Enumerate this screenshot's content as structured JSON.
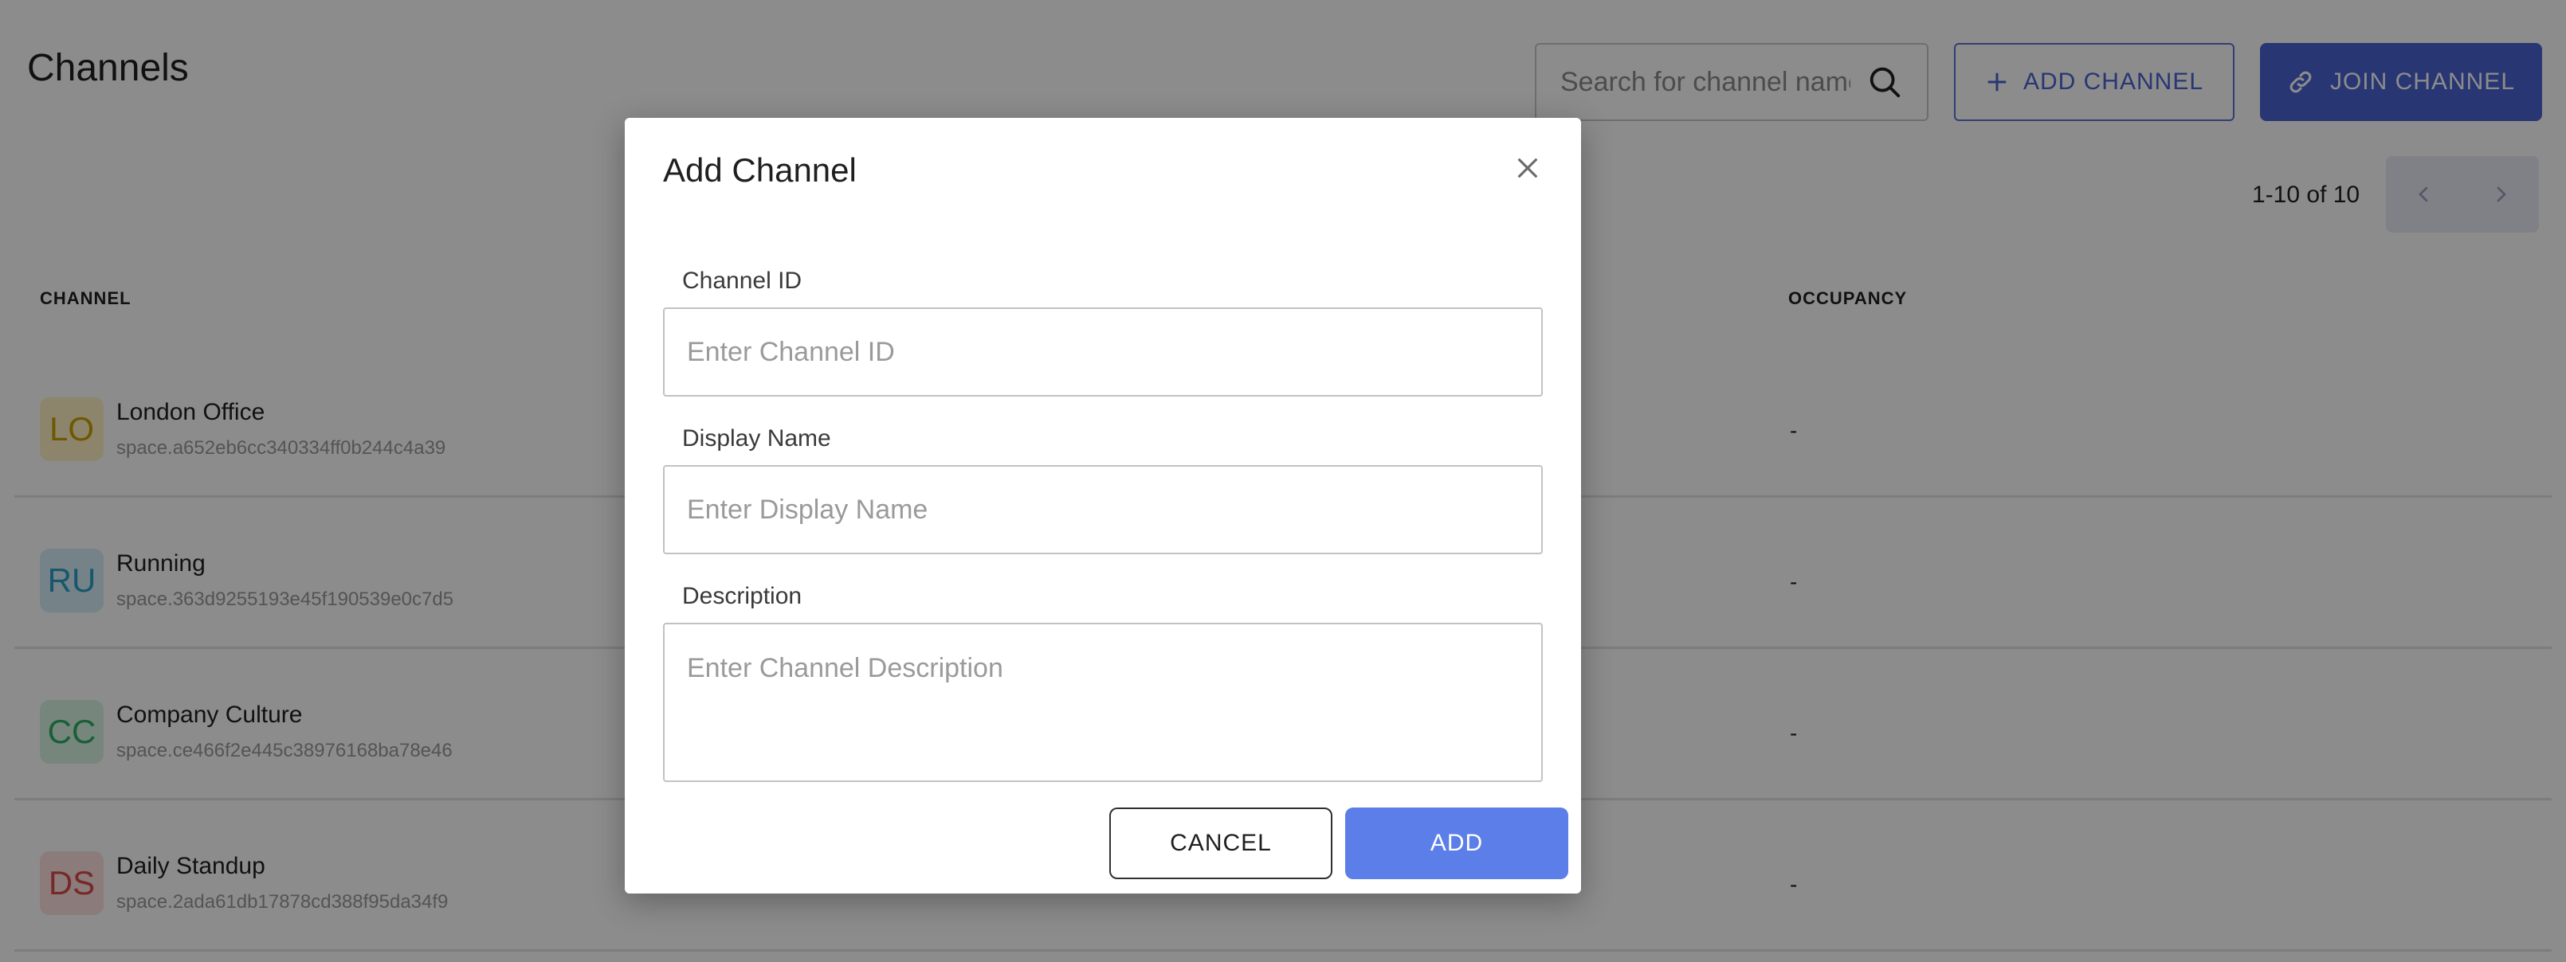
{
  "header": {
    "title": "Channels",
    "search_placeholder": "Search for channel name",
    "add_channel_label": "ADD CHANNEL",
    "join_channel_label": "JOIN CHANNEL"
  },
  "pagination": {
    "info": "1-10 of 10"
  },
  "table": {
    "columns": {
      "channel": "CHANNEL",
      "occupancy": "OCCUPANCY"
    },
    "rows": [
      {
        "initials": "LO",
        "name": "London Office",
        "id": "space.a652eb6cc340334ff0b244c4a39",
        "occupancy": "-",
        "avatar_bg": "#fff3c4",
        "avatar_fg": "#c9a000"
      },
      {
        "initials": "RU",
        "name": "Running",
        "id": "space.363d9255193e45f190539e0c7d5",
        "occupancy": "-",
        "avatar_bg": "#d6eef8",
        "avatar_fg": "#2a9ec9"
      },
      {
        "initials": "CC",
        "name": "Company Culture",
        "id": "space.ce466f2e445c38976168ba78e46",
        "occupancy": "-",
        "avatar_bg": "#d9f5e3",
        "avatar_fg": "#2fb068"
      },
      {
        "initials": "DS",
        "name": "Daily Standup",
        "id": "space.2ada61db17878cd388f95da34f9",
        "occupancy": "-",
        "avatar_bg": "#fde0e0",
        "avatar_fg": "#d94c4c"
      }
    ]
  },
  "modal": {
    "title": "Add Channel",
    "channel_id_label": "Channel ID",
    "channel_id_placeholder": "Enter Channel ID",
    "display_name_label": "Display Name",
    "display_name_placeholder": "Enter Display Name",
    "description_label": "Description",
    "description_placeholder": "Enter Channel Description",
    "cancel_label": "CANCEL",
    "add_label": "ADD"
  },
  "colors": {
    "accent": "#4a63d1",
    "add_button": "#5b7ee8",
    "overlay": "rgba(0,0,0,0.45)"
  },
  "icons": {
    "search": "search-icon",
    "add": "plus-icon",
    "join": "link-icon",
    "prev": "chevron-left-icon",
    "next": "chevron-right-icon",
    "close": "close-icon"
  }
}
